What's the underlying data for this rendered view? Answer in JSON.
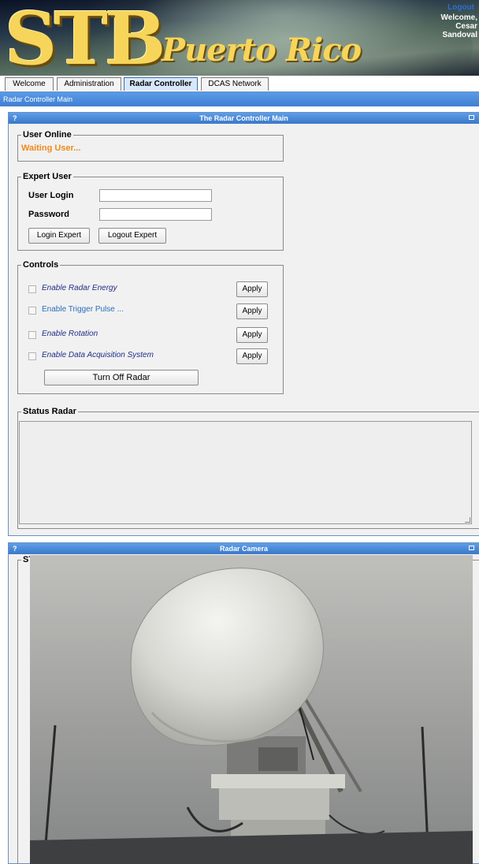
{
  "header": {
    "logo_main": "STB",
    "logo_sub": "Puerto Rico",
    "logout_label": "Logout",
    "welcome_line1": "Welcome,",
    "welcome_line2": "Cesar",
    "welcome_line3": "Sandoval"
  },
  "tabs": [
    {
      "label": "Welcome",
      "active": false
    },
    {
      "label": "Administration",
      "active": false
    },
    {
      "label": "Radar Controller",
      "active": true
    },
    {
      "label": "DCAS Network",
      "active": false
    }
  ],
  "breadcrumb": "Radar Controller Main",
  "main_panel": {
    "help": "?",
    "title": "The Radar Controller Main",
    "user_online": {
      "legend": "User Online",
      "status_text": "Waiting User..."
    },
    "expert_user": {
      "legend": "Expert User",
      "login_label": "User Login",
      "password_label": "Password",
      "login_value": "",
      "password_value": "",
      "login_button": "Login Expert",
      "logout_button": "Logout Expert"
    },
    "controls": {
      "legend": "Controls",
      "items": [
        {
          "label": "Enable Radar Energy",
          "checked": false,
          "apply": "Apply"
        },
        {
          "label": "Enable Trigger Pulse ...",
          "checked": false,
          "apply": "Apply"
        },
        {
          "label": "Enable Rotation",
          "checked": false,
          "apply": "Apply"
        },
        {
          "label": "Enable Data Acquisition System",
          "checked": false,
          "apply": "Apply"
        }
      ],
      "turn_off_button": "Turn Off Radar"
    },
    "status": {
      "legend": "Status Radar",
      "value": ""
    }
  },
  "camera_panel": {
    "help": "?",
    "title": "Radar Camera",
    "legend": "STB Radar"
  },
  "colors": {
    "header_blue": "#4a8ae0",
    "status_orange": "#f08a1a",
    "logo_gold": "#f6d55a",
    "control_text": "#1f2e86"
  }
}
